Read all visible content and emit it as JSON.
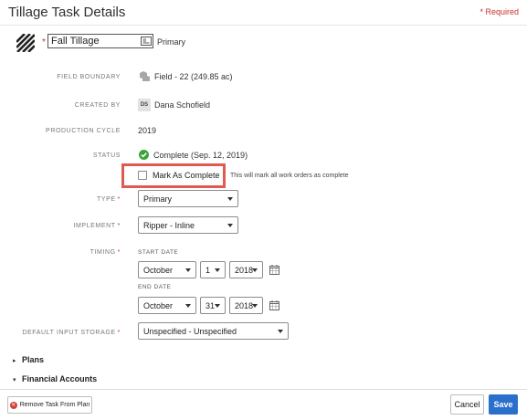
{
  "header": {
    "title": "Tillage Task Details",
    "required_note": "* Required"
  },
  "task": {
    "name_star": "*",
    "name_value": "Fall Tillage",
    "primary_tag": "Primary"
  },
  "fields": {
    "field_boundary": {
      "label": "FIELD BOUNDARY",
      "value": "Field - 22 (249.85 ac)"
    },
    "created_by": {
      "label": "CREATED BY",
      "initials": "DS",
      "value": "Dana Schofield"
    },
    "production_cycle": {
      "label": "PRODUCTION CYCLE",
      "value": "2019"
    },
    "status": {
      "label": "STATUS",
      "value": "Complete (Sep. 12, 2019)"
    }
  },
  "mark_complete": {
    "label": "Mark As Complete",
    "hint": "This will mark all work orders as complete",
    "checked": false
  },
  "type": {
    "label": "TYPE",
    "star": "*",
    "value": "Primary"
  },
  "implement": {
    "label": "IMPLEMENT",
    "star": "*",
    "value": "Ripper - Inline"
  },
  "timing": {
    "label": "TIMING",
    "star": "*",
    "start_label": "START DATE",
    "start_month": "October",
    "start_day": "1",
    "start_year": "2018",
    "end_label": "END DATE",
    "end_month": "October",
    "end_day": "31",
    "end_year": "2018"
  },
  "storage": {
    "label": "DEFAULT INPUT STORAGE",
    "star": "*",
    "value": "Unspecified - Unspecified"
  },
  "sections": {
    "plans": "Plans",
    "financial": "Financial Accounts"
  },
  "footer": {
    "remove_label": "Remove Task From Plan",
    "cancel_label": "Cancel",
    "save_label": "Save"
  },
  "colors": {
    "required": "#c8312d",
    "highlight": "#e05a51",
    "save": "#2a6fcc",
    "complete": "#3aa43a"
  }
}
